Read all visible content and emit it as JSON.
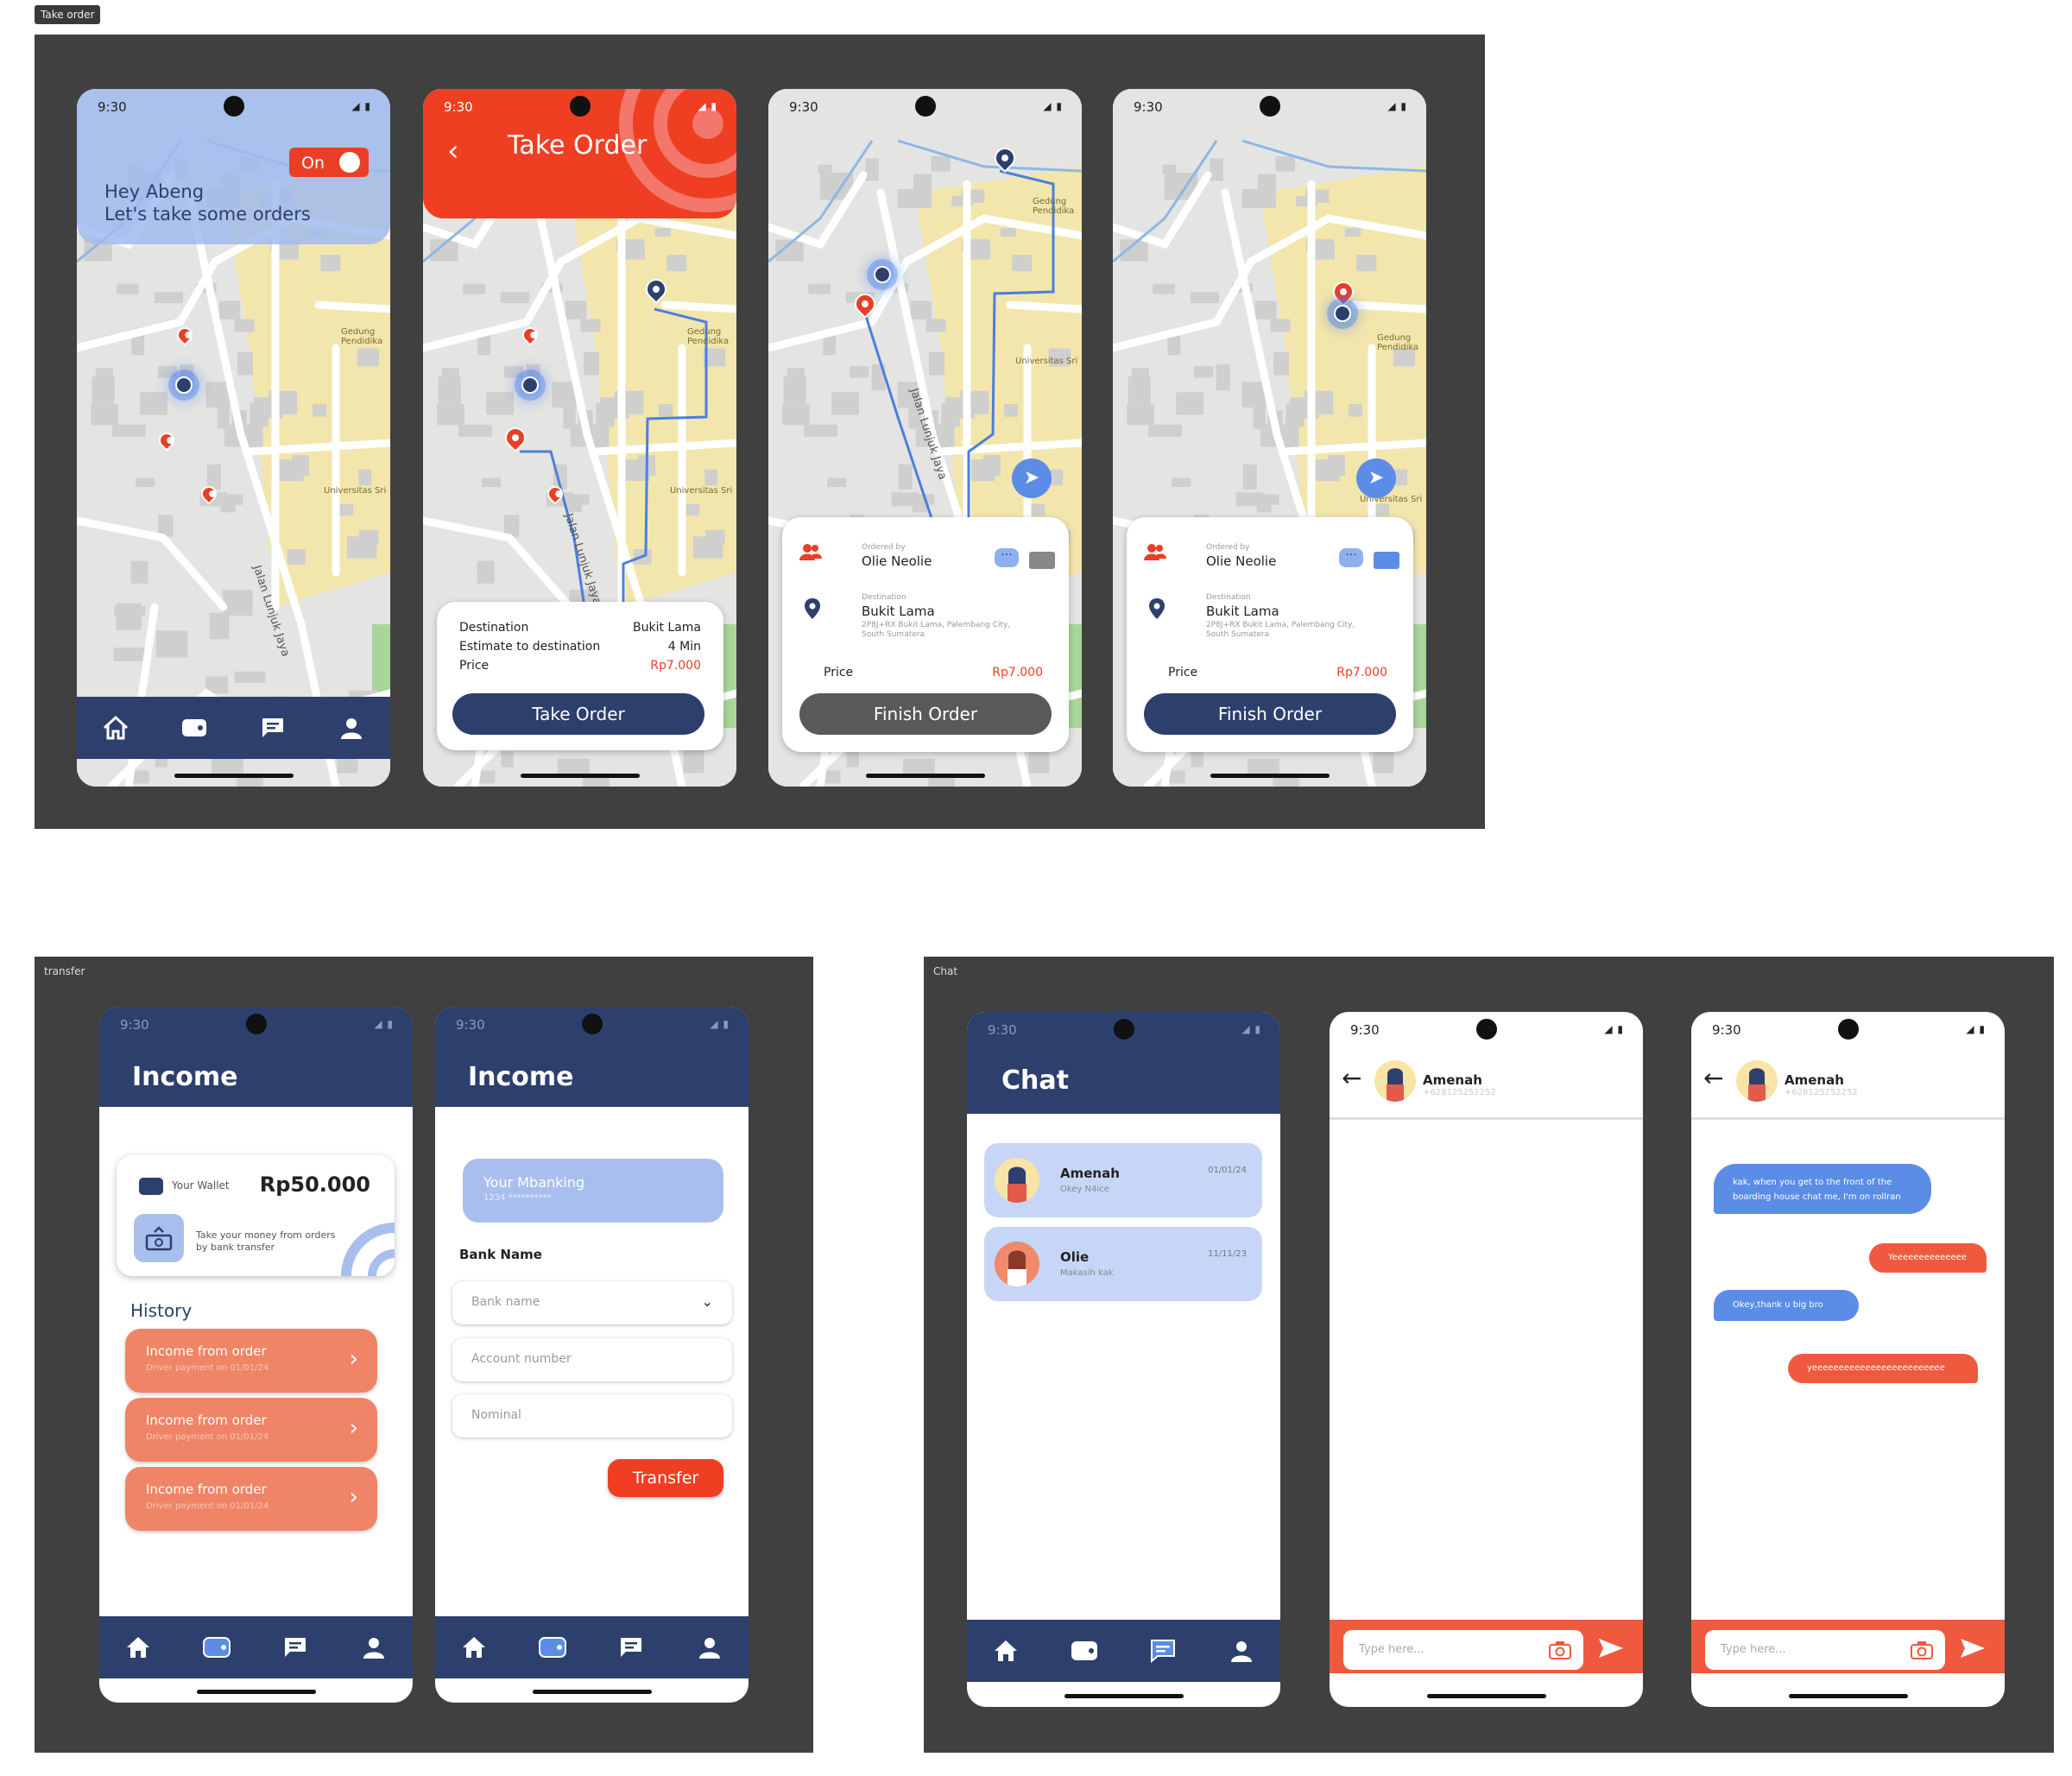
{
  "frames": {
    "take_order": "Take order",
    "transfer": "transfer",
    "chat": "Chat"
  },
  "status_time": "9:30",
  "colors": {
    "navy": "#2d3f6c",
    "orange": "#ef5a3f",
    "accent_blue": "#5b8de6",
    "salmon": "#ef8566"
  },
  "screen1": {
    "toggle_label": "On",
    "greeting": "Hey Abeng",
    "subtitle": "Let's take some orders",
    "street": "Jalan Lunjuk Jaya",
    "poi1": "Gedung Pendidika",
    "poi2": "Universitas Sri"
  },
  "screen2": {
    "title": "Take Order",
    "destination_label": "Destination",
    "destination_value": "Bukit Lama",
    "estimate_label": "Estimate to destination",
    "estimate_value": "4 Min",
    "price_label": "Price",
    "price_value": "Rp7.000",
    "button": "Take Order",
    "street": "Jalan Lunjuk Jaya",
    "poi1": "Gedung Pendidika",
    "poi2": "Universitas Sri"
  },
  "screen3": {
    "ordered_by_label": "Ordered by",
    "customer": "Olie Neolie",
    "destination_label": "Destination",
    "destination": "Bukit Lama",
    "address_line1": "2P8J+RX Bukit Lama, Palembang City,",
    "address_line2": "South Sumatera",
    "price_label": "Price",
    "price_value": "Rp7.000",
    "button": "Finish Order",
    "street": "Jalan Lunjuk Jaya",
    "poi1": "Gedung Pendidika",
    "poi2": "Universitas Sri"
  },
  "screen4": {
    "ordered_by_label": "Ordered by",
    "customer": "Olie Neolie",
    "destination_label": "Destination",
    "destination": "Bukit Lama",
    "address_line1": "2P8J+RX Bukit Lama, Palembang City,",
    "address_line2": "South Sumatera",
    "price_label": "Price",
    "price_value": "Rp7.000",
    "button": "Finish Order",
    "poi1": "Gedung Pendidika",
    "poi2": "Universitas Sri"
  },
  "income1": {
    "title": "Income",
    "wallet_label": "Your Wallet",
    "wallet_amount": "Rp50.000",
    "transfer_hint_line1": "Take your money from orders",
    "transfer_hint_line2": "by bank transfer",
    "history_title": "History",
    "history": [
      {
        "title": "Income from order",
        "subtitle": "Driver payment on 01/01/24"
      },
      {
        "title": "Income from order",
        "subtitle": "Driver payment on 01/01/24"
      },
      {
        "title": "Income from order",
        "subtitle": "Driver payment on 01/01/24"
      }
    ]
  },
  "income2": {
    "title": "Income",
    "mbanking_title": "Your Mbanking",
    "mbanking_number": "1234 **********",
    "bank_name_label": "Bank Name",
    "bank_placeholder": "Bank name",
    "account_placeholder": "Account number",
    "nominal_placeholder": "Nominal",
    "transfer_button": "Transfer"
  },
  "chat_list": {
    "title": "Chat",
    "items": [
      {
        "name": "Amenah",
        "preview": "Okey N4ice",
        "date": "01/01/24"
      },
      {
        "name": "Olie",
        "preview": "Makasih kak",
        "date": "11/11/23"
      }
    ]
  },
  "chat_room": {
    "contact_name": "Amenah",
    "contact_phone": "+628125252252",
    "input_placeholder": "Type here..."
  },
  "chat_room2": {
    "contact_name": "Amenah",
    "contact_phone": "+628125252252",
    "input_placeholder": "Type here...",
    "messages": [
      {
        "from": "them",
        "line1": "kak, when you get to the front of the",
        "line2": "boarding house chat me, I'm on rollran"
      },
      {
        "from": "me",
        "line1": "Yeeeeeeeeeeeeee"
      },
      {
        "from": "them",
        "line1": "Okey,thank u big bro"
      },
      {
        "from": "me",
        "line1": "yeeeeeeeeeeeeeeeeeeeeeeeee"
      }
    ]
  }
}
